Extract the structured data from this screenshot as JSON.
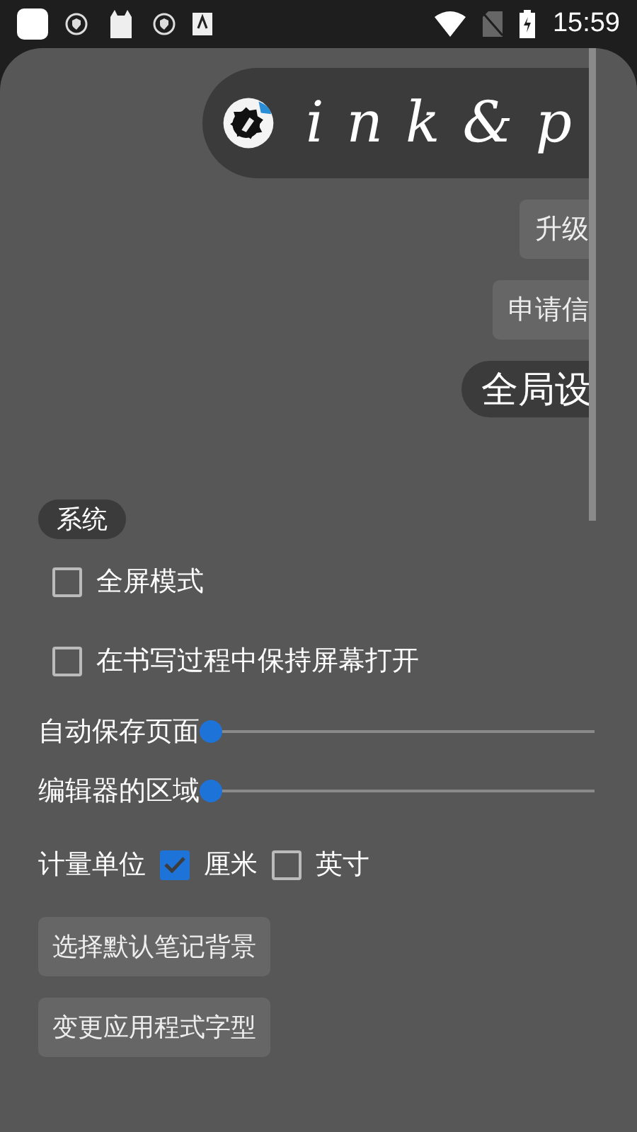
{
  "status_bar": {
    "time": "15:59"
  },
  "header": {
    "title": "ink&p"
  },
  "top_buttons": [
    {
      "label": "升级",
      "kind": "small"
    },
    {
      "label": "申请信",
      "kind": "small"
    },
    {
      "label": "全局设",
      "kind": "pill"
    }
  ],
  "section": {
    "title": "系统"
  },
  "options": [
    {
      "label": "全屏模式",
      "checked": false
    },
    {
      "label": "在书写过程中保持屏幕打开",
      "checked": false
    }
  ],
  "sliders": [
    {
      "label": "自动保存页面",
      "level": 0
    },
    {
      "label": "编辑器的区域",
      "level": 0
    }
  ],
  "units": {
    "label": "计量单位",
    "choices": [
      {
        "label": "厘米",
        "checked": true
      },
      {
        "label": "英寸",
        "checked": false
      }
    ]
  },
  "buttons": [
    "选择默认笔记背景",
    "变更应用程式字型"
  ]
}
